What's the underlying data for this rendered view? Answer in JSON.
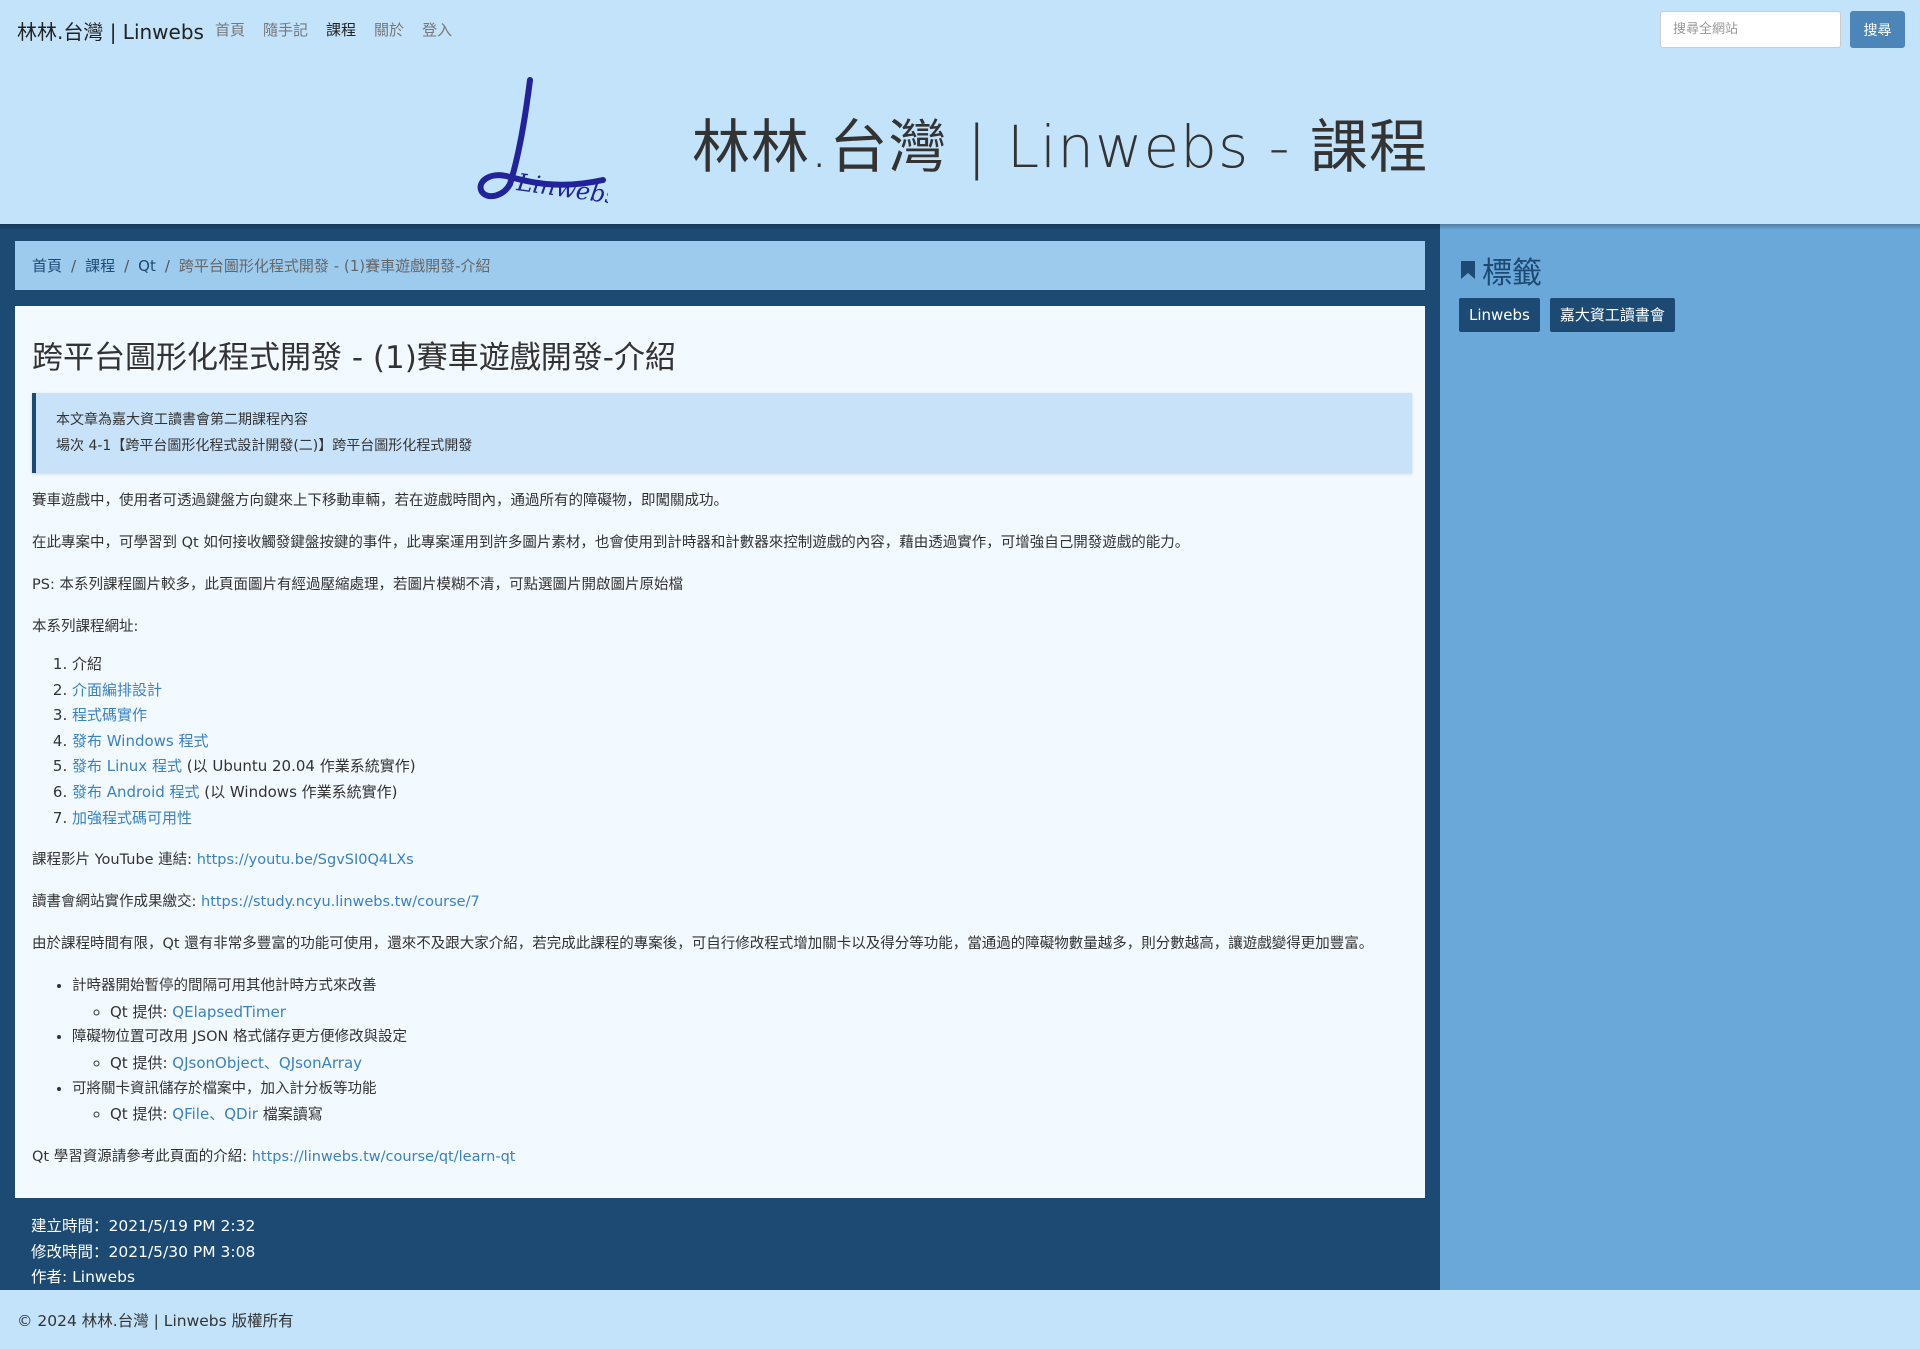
{
  "nav": {
    "brand": "林林.台灣 | Linwebs",
    "links": [
      "首頁",
      "隨手記",
      "課程",
      "關於",
      "登入"
    ],
    "search_placeholder": "搜尋全網站",
    "search_button": "搜尋"
  },
  "hero": {
    "logo_text": "Linwebs",
    "title": "林林.台灣 | Linwebs - 課程"
  },
  "breadcrumb": [
    "首頁",
    "課程",
    "Qt",
    "跨平台圖形化程式開發 - (1)賽車遊戲開發-介紹"
  ],
  "article": {
    "title": "跨平台圖形化程式開發 - (1)賽車遊戲開發-介紹",
    "callout": [
      "本文章為嘉大資工讀書會第二期課程內容",
      "場次 4-1【跨平台圖形化程式設計開發(二)】跨平台圖形化程式開發"
    ],
    "p1": "賽車遊戲中，使用者可透過鍵盤方向鍵來上下移動車輛，若在遊戲時間內，通過所有的障礙物，即闖關成功。",
    "p2": "在此專案中，可學習到 Qt 如何接收觸發鍵盤按鍵的事件，此專案運用到許多圖片素材，也會使用到計時器和計數器來控制遊戲的內容，藉由透過實作，可增強自己開發遊戲的能力。",
    "p3": "PS: 本系列課程圖片較多，此頁面圖片有經過壓縮處理，若圖片模糊不清，可點選圖片開啟圖片原始檔",
    "p4": "本系列課程網址:",
    "list": {
      "i1": "介紹",
      "i2": "介面編排設計",
      "i3": "程式碼實作",
      "i4": "發布 Windows 程式",
      "i5_link": "發布 Linux 程式",
      "i5_rest": " (以 Ubuntu 20.04 作業系統實作)",
      "i6_link": "發布 Android 程式",
      "i6_rest": " (以 Windows 作業系統實作)",
      "i7": "加強程式碼可用性"
    },
    "youtube_label": "課程影片 YouTube 連結: ",
    "youtube_url": "https://youtu.be/SgvSI0Q4LXs",
    "study_label": "讀書會網站實作成果繳交: ",
    "study_url": "https://study.ncyu.linwebs.tw/course/7",
    "p5": "由於課程時間有限，Qt 還有非常多豐富的功能可使用，還來不及跟大家介紹，若完成此課程的專案後，可自行修改程式增加關卡以及得分等功能，當通過的障礙物數量越多，則分數越高，讓遊戲變得更加豐富。",
    "todo": {
      "t1": "計時器開始暫停的間隔可用其他計時方式來改善",
      "t1_prefix": "Qt 提供: ",
      "t1_link": "QElapsedTimer",
      "t2": "障礙物位置可改用 JSON 格式儲存更方便修改與設定",
      "t2_prefix": "Qt 提供: ",
      "t2_link1": "QJsonObject",
      "t2_sep": "、",
      "t2_link2": "QJsonArray",
      "t3": "可將關卡資訊儲存於檔案中，加入計分板等功能",
      "t3_prefix": "Qt 提供: ",
      "t3_link1": "QFile",
      "t3_sep": "、",
      "t3_link2": "QDir",
      "t3_suffix": " 檔案讀寫"
    },
    "learn_label": "Qt 學習資源請參考此頁面的介紹: ",
    "learn_url": "https://linwebs.tw/course/qt/learn-qt"
  },
  "meta": {
    "created": "建立時間：2021/5/19 PM 2:32",
    "modified": "修改時間：2021/5/30 PM 3:08",
    "author": "作者: Linwebs"
  },
  "sidebar": {
    "title": "標籤",
    "tags": [
      "Linwebs",
      "嘉大資工讀書會"
    ]
  },
  "footer": {
    "copyright": "© 2024 林林.台灣 | Linwebs 版權所有"
  },
  "colors": {
    "page_bg": "#c3e3fb",
    "main_bg": "#1c4a73",
    "sidebar_bg": "#6aa8da",
    "link": "#3a82c0",
    "button": "#4c86b8"
  }
}
